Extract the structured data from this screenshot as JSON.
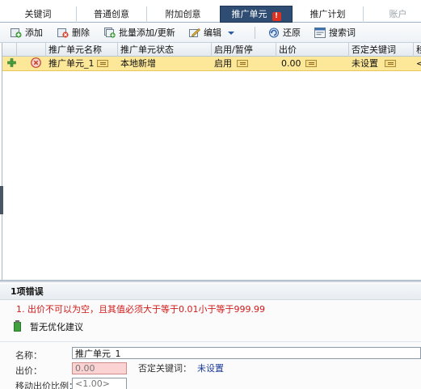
{
  "tabs": [
    {
      "label": "关键词",
      "state": "normal"
    },
    {
      "label": "普通创意",
      "state": "normal"
    },
    {
      "label": "附加创意",
      "state": "normal"
    },
    {
      "label": "推广单元",
      "state": "active",
      "badge": "!"
    },
    {
      "label": "推广计划",
      "state": "normal"
    },
    {
      "label": "账户",
      "state": "disabled"
    }
  ],
  "toolbar": {
    "add": "添加",
    "delete": "删除",
    "batch_add": "批量添加/更新",
    "edit": "编辑",
    "restore": "还原",
    "search_word": "搜索词"
  },
  "grid": {
    "headers": [
      "推广单元名称",
      "推广单元状态",
      "启用/暂停",
      "出价",
      "否定关键词",
      "移"
    ],
    "rows": [
      {
        "name": "推广单元_1",
        "status": "本地新增",
        "enabled": "启用",
        "bid": "0.00",
        "negative_keywords": "未设置",
        "extra": "<"
      }
    ]
  },
  "errors": {
    "title": "1项错误",
    "items": [
      "1. 出价不可以为空，且其值必须大于等于0.01小于等于999.99"
    ]
  },
  "suggestion": "暂无优化建议",
  "form": {
    "name_label": "名称：",
    "name_value": "推广单元_1",
    "bid_label": "出价：",
    "bid_placeholder": "0.00",
    "neg_label": "否定关键词：",
    "neg_value": "未设置",
    "ratio_label": "移动出价比例：",
    "ratio_placeholder": "<1.00>"
  },
  "colors": {
    "active_tab": "#2f4d73",
    "selected_row": "#fde89a",
    "error_text": "#d11a1a",
    "link_blue": "#1a3a9a"
  }
}
